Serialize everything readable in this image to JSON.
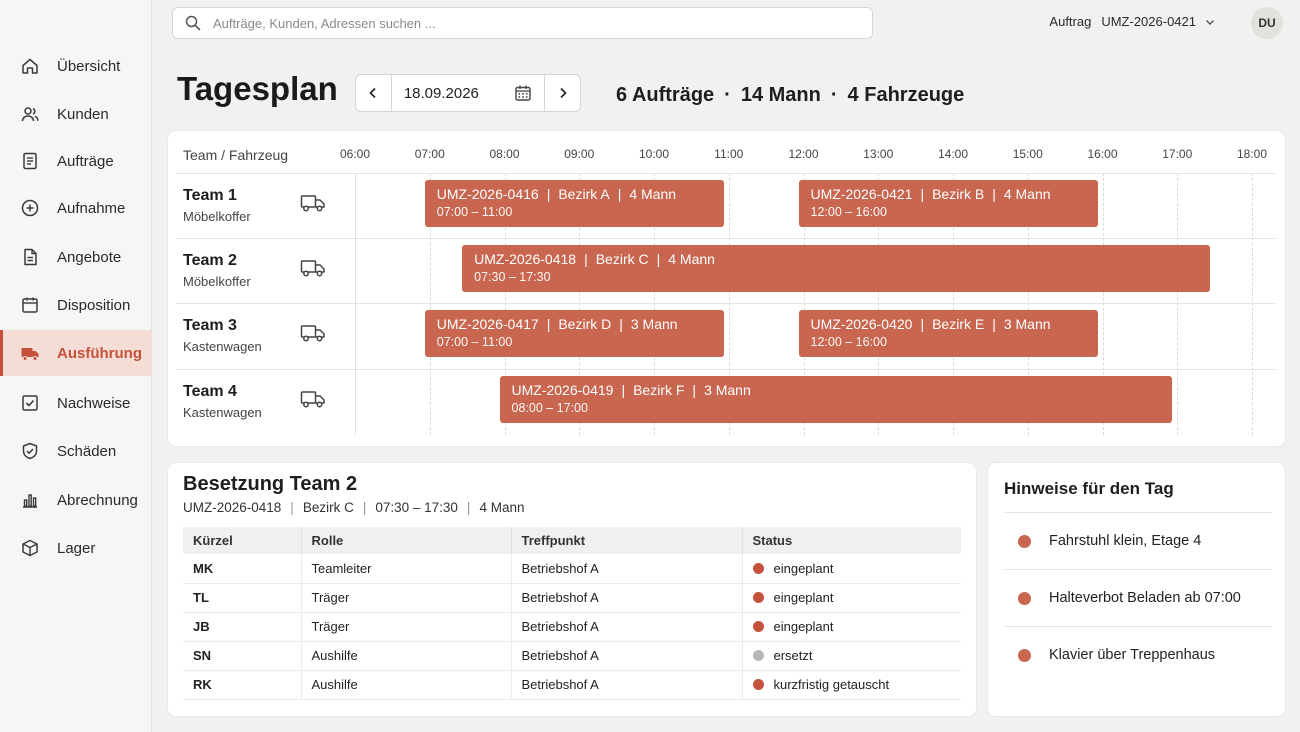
{
  "sidebar": {
    "items": [
      {
        "label": "Übersicht",
        "icon": "home-icon"
      },
      {
        "label": "Kunden",
        "icon": "users-icon"
      },
      {
        "label": "Aufträge",
        "icon": "document-icon"
      },
      {
        "label": "Aufnahme",
        "icon": "plus-circle-icon"
      },
      {
        "label": "Angebote",
        "icon": "file-icon"
      },
      {
        "label": "Disposition",
        "icon": "calendar-icon"
      },
      {
        "label": "Ausführung",
        "icon": "truck-icon",
        "active": true
      },
      {
        "label": "Nachweise",
        "icon": "checkbox-icon"
      },
      {
        "label": "Schäden",
        "icon": "shield-icon"
      },
      {
        "label": "Abrechnung",
        "icon": "bar-chart-icon"
      },
      {
        "label": "Lager",
        "icon": "box-icon"
      }
    ]
  },
  "topbar": {
    "search_placeholder": "Aufträge, Kunden, Adressen suchen ...",
    "order_label": "Auftrag",
    "order_value": "UMZ-2026-0421",
    "avatar": "DU"
  },
  "header": {
    "title": "Tagesplan",
    "date": "18.09.2026",
    "summary": {
      "orders": "6 Aufträge",
      "men": "14 Mann",
      "vehicles": "4 Fahrzeuge"
    }
  },
  "gantt": {
    "column_label": "Team / Fahrzeug",
    "hours": [
      "06:00",
      "07:00",
      "08:00",
      "09:00",
      "10:00",
      "11:00",
      "12:00",
      "13:00",
      "14:00",
      "15:00",
      "16:00",
      "17:00",
      "18:00"
    ],
    "teams": [
      {
        "name": "Team 1",
        "vehicle": "Möbelkoffer"
      },
      {
        "name": "Team 2",
        "vehicle": "Möbelkoffer"
      },
      {
        "name": "Team 3",
        "vehicle": "Kastenwagen"
      },
      {
        "name": "Team 4",
        "vehicle": "Kastenwagen"
      }
    ],
    "jobs": [
      {
        "team": 0,
        "id": "UMZ-2026-0416",
        "bezirk": "Bezirk A",
        "crew": "4 Mann",
        "time": "07:00 – 11:00",
        "start": 7,
        "end": 11
      },
      {
        "team": 0,
        "id": "UMZ-2026-0421",
        "bezirk": "Bezirk B",
        "crew": "4 Mann",
        "time": "12:00 – 16:00",
        "start": 12,
        "end": 16
      },
      {
        "team": 1,
        "id": "UMZ-2026-0418",
        "bezirk": "Bezirk C",
        "crew": "4 Mann",
        "time": "07:30 – 17:30",
        "start": 7.5,
        "end": 17.5
      },
      {
        "team": 2,
        "id": "UMZ-2026-0417",
        "bezirk": "Bezirk D",
        "crew": "3 Mann",
        "time": "07:00 – 11:00",
        "start": 7,
        "end": 11
      },
      {
        "team": 2,
        "id": "UMZ-2026-0420",
        "bezirk": "Bezirk E",
        "crew": "3 Mann",
        "time": "12:00 – 16:00",
        "start": 12,
        "end": 16
      },
      {
        "team": 3,
        "id": "UMZ-2026-0419",
        "bezirk": "Bezirk F",
        "crew": "3 Mann",
        "time": "08:00 – 17:00",
        "start": 8,
        "end": 17
      }
    ]
  },
  "crew": {
    "title": "Besetzung Team 2",
    "meta": [
      "UMZ-2026-0418",
      "Bezirk C",
      "07:30 – 17:30",
      "4 Mann"
    ],
    "columns": [
      "Kürzel",
      "Rolle",
      "Treffpunkt",
      "Status"
    ],
    "rows": [
      {
        "code": "MK",
        "role": "Teamleiter",
        "meet": "Betriebshof A",
        "status": "eingeplant",
        "status_color": "#c5513c"
      },
      {
        "code": "TL",
        "role": "Träger",
        "meet": "Betriebshof A",
        "status": "eingeplant",
        "status_color": "#c5513c"
      },
      {
        "code": "JB",
        "role": "Träger",
        "meet": "Betriebshof A",
        "status": "eingeplant",
        "status_color": "#c5513c"
      },
      {
        "code": "SN",
        "role": "Aushilfe",
        "meet": "Betriebshof A",
        "status": "ersetzt",
        "status_color": "#b8b6b2"
      },
      {
        "code": "RK",
        "role": "Aushilfe",
        "meet": "Betriebshof A",
        "status": "kurzfristig getauscht",
        "status_color": "#c5513c"
      }
    ]
  },
  "notes": {
    "title": "Hinweise für den Tag",
    "items": [
      "Fahrstuhl klein, Etage 4",
      "Halteverbot Beladen ab 07:00",
      "Klavier über Treppenhaus"
    ]
  },
  "colors": {
    "accent": "#c8664f",
    "active_nav": "#c5513c"
  }
}
